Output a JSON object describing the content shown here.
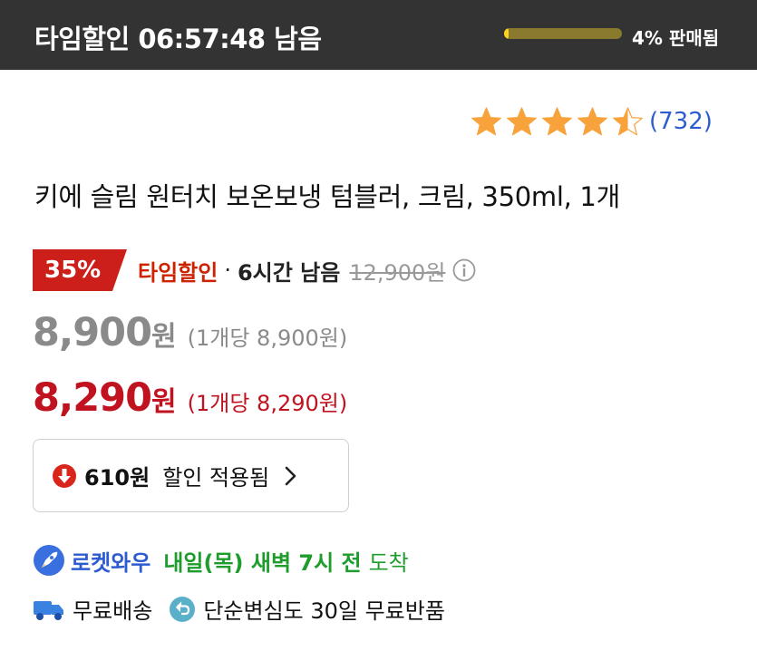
{
  "topbar": {
    "timer_text": "타임할인 06:57:48 남음",
    "sold_text": "4% 판매됨",
    "sold_fraction": 0.04
  },
  "rating": {
    "stars": 4.5,
    "review_count": "(732)"
  },
  "product": {
    "title": "키에 슬림 원터치 보온보냉 텀블러, 크림, 350ml, 1개"
  },
  "promo": {
    "discount_badge": "35%",
    "name": "타임할인",
    "separator": "·",
    "remaining": "6시간 남음",
    "original_price": "12,900원"
  },
  "prices": {
    "sale_price": "8,900",
    "sale_unit": "원",
    "sale_per_unit": "(1개당 8,900원)",
    "final_price": "8,290",
    "final_unit": "원",
    "final_per_unit": "(1개당 8,290원)"
  },
  "discount": {
    "amount": "610원",
    "label": "할인 적용됨"
  },
  "delivery": {
    "brand": "로켓와우",
    "arrival": "내일(목) 새벽 7시 전",
    "arrival_suffix": "도착",
    "free_shipping": "무료배송",
    "returns": "단순변심도 30일 무료반품"
  },
  "colors": {
    "topbar_bg": "#333333",
    "progress_fill": "#ffd21f",
    "star": "#f7a23b",
    "link_blue": "#2d5bd0",
    "price_red": "#c1121f",
    "badge_red": "#cc1f1a",
    "arrival_green": "#1f9d2c"
  },
  "icons": {
    "star": "star-icon",
    "info": "info-icon",
    "discount": "arrow-down-circle-icon",
    "chevron": "chevron-right-icon",
    "rocket": "rocket-icon",
    "truck": "truck-icon",
    "return": "return-arrow-icon"
  }
}
